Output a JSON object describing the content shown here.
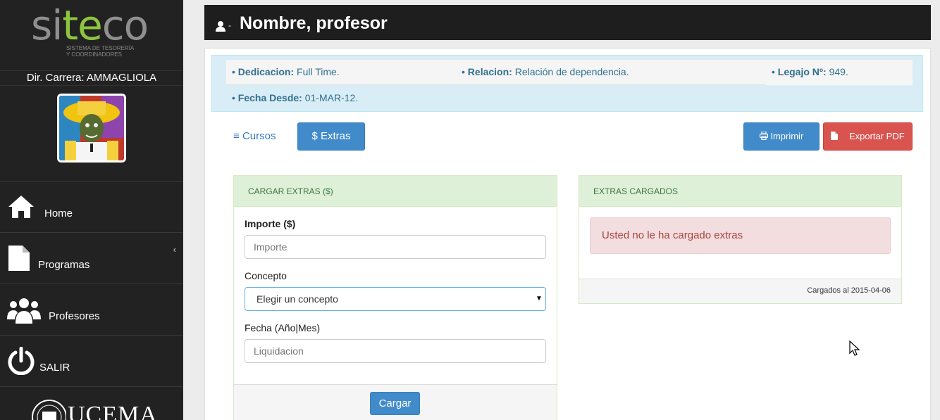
{
  "sidebar": {
    "logo_word_prefix": "si",
    "logo_word_accent": "te",
    "logo_word_suffix": "co",
    "logo_sub_line1": "SISTEMA DE TESORERÍA",
    "logo_sub_line2": "Y COORDINADORES",
    "director_label": "Dir. Carrera: AMMAGLIOLA",
    "nav": [
      {
        "label": "Home",
        "icon": "home-icon"
      },
      {
        "label": "Programas",
        "icon": "file-icon"
      },
      {
        "label": "Profesores",
        "icon": "users-icon"
      },
      {
        "label": "SALIR",
        "icon": "power-icon"
      }
    ],
    "footer_logo": "UCEMA"
  },
  "header": {
    "dash": "-",
    "title": "Nombre, profesor"
  },
  "info": {
    "dedicacion_label": "Dedicacion:",
    "dedicacion_value": "Full Time.",
    "relacion_label": "Relacion:",
    "relacion_value": "Relación de dependencia.",
    "legajo_label": "Legajo Nº:",
    "legajo_value": "949.",
    "fecha_label": "Fecha Desde:",
    "fecha_value": "01-MAR-12."
  },
  "toolbar": {
    "cursos_label": "Cursos",
    "extras_label": "Extras",
    "imprimir_label": "Imprimir",
    "exportar_label": "Exportar PDF"
  },
  "cargar_extras": {
    "heading": "CARGAR EXTRAS ($)",
    "importe_label": "Importe ($)",
    "importe_placeholder": "Importe",
    "concepto_label": "Concepto",
    "concepto_selected": "Elegir un concepto",
    "fecha_label": "Fecha (Año|Mes)",
    "fecha_placeholder": "Liquidacion",
    "submit_label": "Cargar"
  },
  "extras_cargados": {
    "heading": "EXTRAS CARGADOS",
    "empty_message": "Usted no le ha cargado extras",
    "footer_text": "Cargados al 2015-04-06"
  },
  "colors": {
    "sidebar_bg": "#222222",
    "header_bg": "#1e1e1e",
    "primary": "#428bca",
    "danger": "#d9534f",
    "logo_green": "#8cc63e"
  }
}
